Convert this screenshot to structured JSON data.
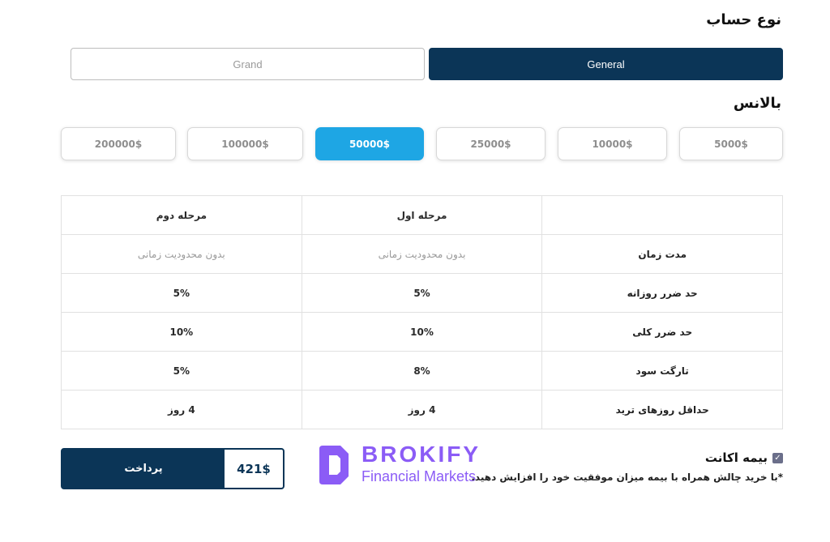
{
  "account_type": {
    "title": "نوع حساب",
    "options": [
      "General",
      "Grand"
    ],
    "selected": "General"
  },
  "balance": {
    "title": "بالانس",
    "options": [
      "5000$",
      "10000$",
      "25000$",
      "50000$",
      "100000$",
      "200000$"
    ],
    "selected": "50000$"
  },
  "table": {
    "headers": [
      "",
      "مرحله اول",
      "مرحله دوم"
    ],
    "rows": [
      {
        "label": "مدت زمان",
        "phase1": "بدون محدودیت زمانی",
        "phase2": "بدون محدودیت زمانی"
      },
      {
        "label": "حد ضرر روزانه",
        "phase1": "5%",
        "phase2": "5%"
      },
      {
        "label": "حد ضرر کلی",
        "phase1": "10%",
        "phase2": "10%"
      },
      {
        "label": "تارگت سود",
        "phase1": "8%",
        "phase2": "5%"
      },
      {
        "label": "حداقل روزهای ترید",
        "phase1": "4 روز",
        "phase2": "4 روز"
      }
    ]
  },
  "payment": {
    "price": "421$",
    "button_label": "پرداخت"
  },
  "logo": {
    "word": "BROKIFY",
    "sub": "Financial Markets",
    "color": "#8b5cf6"
  },
  "insurance": {
    "checked": true,
    "label": "بیمه اکانت",
    "note": "*با خرید چالش همراه با بیمه میزان موفقیت خود را افزایش دهید."
  },
  "colors": {
    "primary": "#0b3557",
    "accent": "#1ea6e4"
  }
}
